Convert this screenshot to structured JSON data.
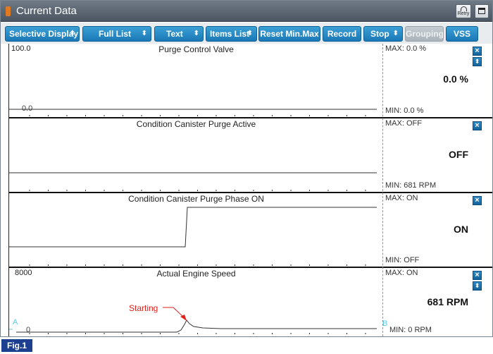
{
  "window": {
    "title": "Current Data",
    "retry_label": "Retry"
  },
  "toolbar": {
    "buttons": [
      {
        "label": "Selective Display",
        "dropdown": true
      },
      {
        "label": "Full List",
        "dropdown": true
      },
      {
        "label": "Text",
        "dropdown": true
      },
      {
        "label": "Items List",
        "dropdown": true
      },
      {
        "label": "Reset Min.Max",
        "dropdown": false
      },
      {
        "label": "Record",
        "dropdown": false
      },
      {
        "label": "Stop",
        "dropdown": true
      },
      {
        "label": "Grouping",
        "dropdown": false,
        "disabled": true
      },
      {
        "label": "VSS",
        "dropdown": false
      }
    ],
    "dropdown_arrow": "⬍"
  },
  "panels": [
    {
      "title": "Purge Control Valve",
      "y_top_label": "100.0",
      "y_bottom_label": "0.0",
      "max_text": "MAX:   0.0 %",
      "current_value": "0.0 %",
      "min_text": "MIN:   0.0 %"
    },
    {
      "title": "Condition Canister Purge Active",
      "max_text": "MAX: OFF",
      "current_value": "OFF",
      "min_text": "MIN:   681 RPM"
    },
    {
      "title": "Condition Canister Purge Phase ON",
      "max_text": "MAX: ON",
      "current_value": "ON",
      "min_text": "MIN: OFF"
    },
    {
      "title": "Actual Engine Speed",
      "y_top_label": "8000",
      "y_bottom_label": "0",
      "cursor_a": "A",
      "cursor_b": "B",
      "annotation": "Starting",
      "max_text": "MAX: ON",
      "current_value": "681 RPM",
      "min_text": "MIN:     0 RPM"
    }
  ],
  "panel_buttons": {
    "close_glyph": "×",
    "scroll_glyph": "⬍"
  },
  "colors": {
    "annotation": "#e0201a",
    "cursor": "#5ec8e8",
    "button_blue": "#1f84c4",
    "fig_label_bg": "#1c3f8f"
  },
  "figure_label": "Fig.1"
}
